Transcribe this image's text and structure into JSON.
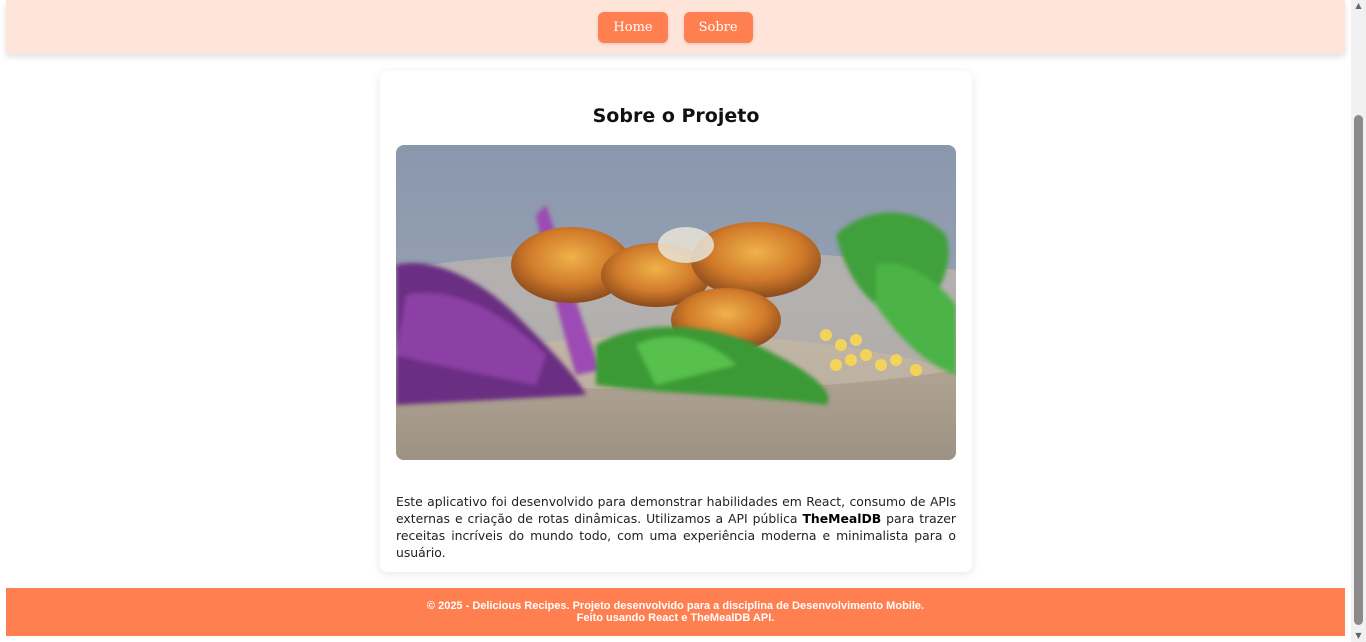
{
  "nav": {
    "home_label": "Home",
    "about_label": "Sobre"
  },
  "card": {
    "title": "Sobre o Projeto",
    "image_alt": "salad-bowl-photo",
    "desc_part1": "Este aplicativo foi desenvolvido para demonstrar habilidades em React, consumo de APIs externas e criação de rotas dinâmicas. Utilizamos a API pública ",
    "desc_bold": "TheMealDB",
    "desc_part2": " para trazer receitas incríveis do mundo todo, com uma experiência moderna e minimalista para o usuário."
  },
  "footer": {
    "line1": "© 2025 - Delicious Recipes. Projeto desenvolvido para a disciplina de Desenvolvimento Mobile.",
    "line2": "Feito usando React e TheMealDB API."
  },
  "colors": {
    "navbar_bg": "#ffe4da",
    "accent": "#ff7f50",
    "footer_text": "#ffffff"
  }
}
